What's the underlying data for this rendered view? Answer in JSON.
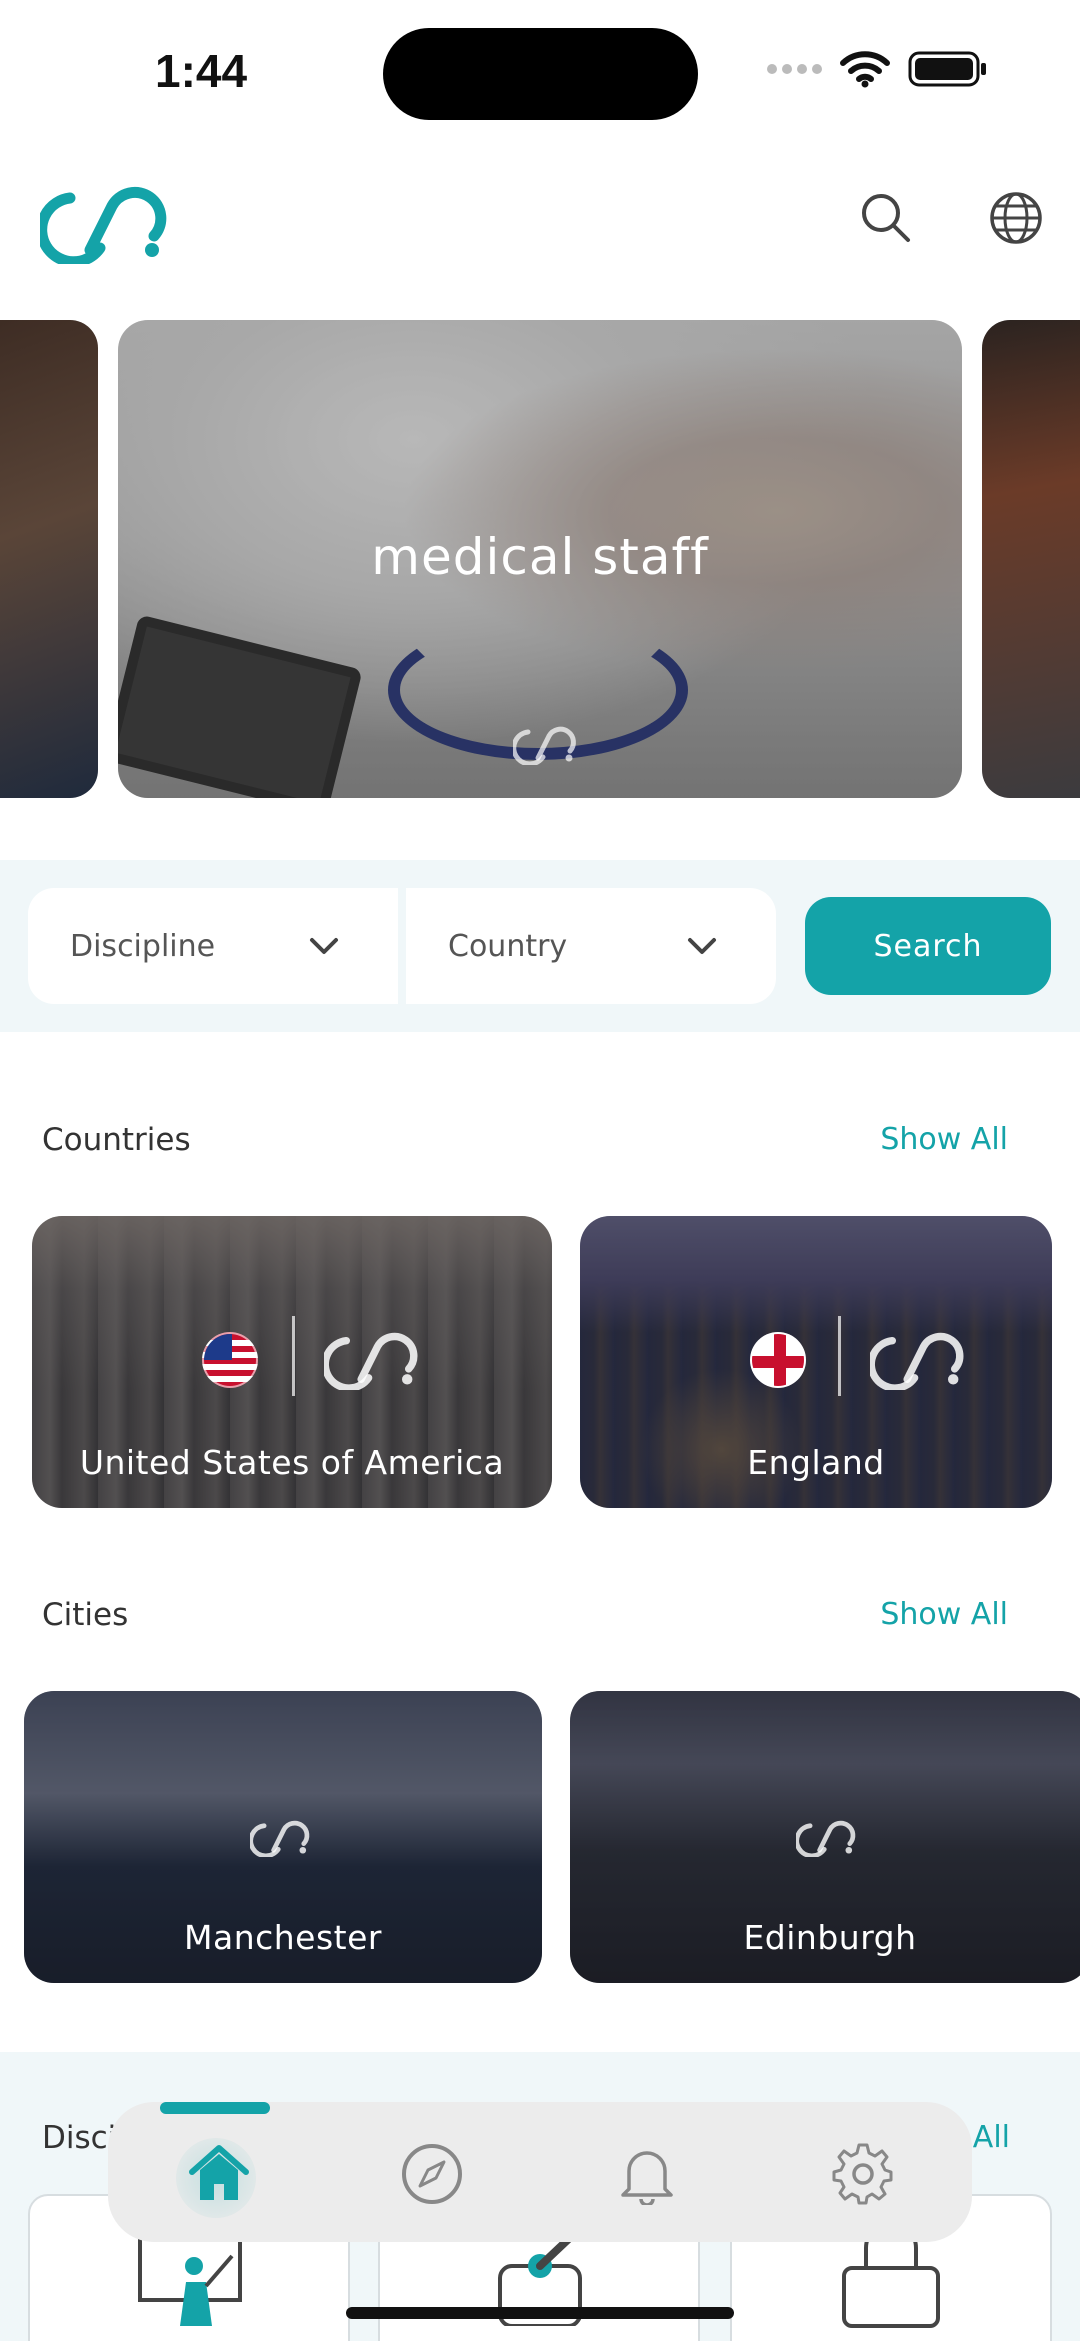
{
  "status_bar": {
    "time": "1:44"
  },
  "header": {
    "logo_icon": "brand-logo-icon",
    "search_icon": "search-icon",
    "language_icon": "globe-icon"
  },
  "hero": {
    "title": "medical staff"
  },
  "filters": {
    "discipline_label": "Discipline",
    "country_label": "Country",
    "search_label": "Search"
  },
  "countries": {
    "title": "Countries",
    "show_all": "Show All",
    "items": [
      {
        "name": "United States of America"
      },
      {
        "name": "England"
      }
    ]
  },
  "cities": {
    "title": "Cities",
    "show_all": "Show All",
    "items": [
      {
        "name": "Manchester"
      },
      {
        "name": "Edinburgh"
      }
    ]
  },
  "disciplines": {
    "title": "Discipline",
    "show_all": "Show All"
  },
  "bottom_nav": {
    "items": [
      "home-icon",
      "compass-icon",
      "bell-icon",
      "gear-icon"
    ],
    "active_index": 0
  },
  "colors": {
    "accent": "#14a3a8",
    "panel": "#f0f7f9"
  }
}
